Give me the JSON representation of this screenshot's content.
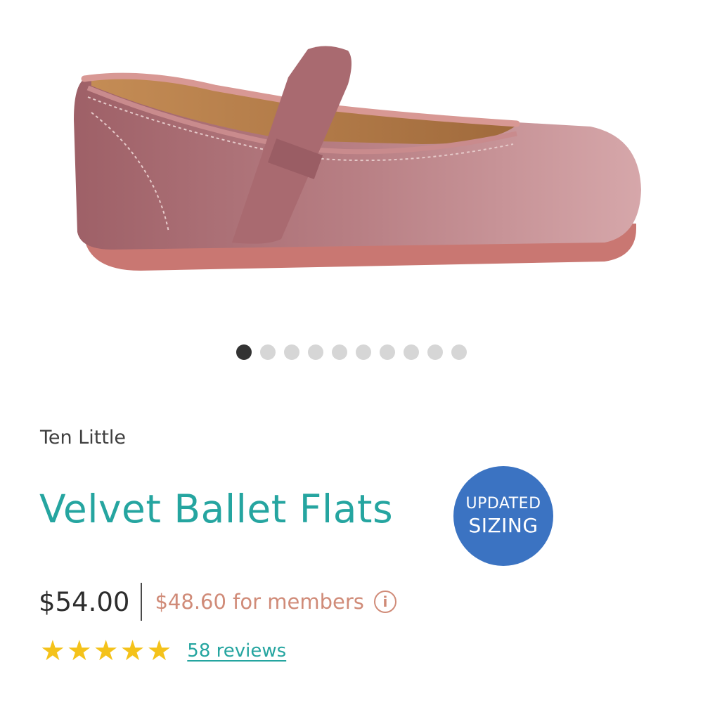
{
  "product": {
    "image_icon": "velvet-ballet-flat-image",
    "brand": "Ten Little",
    "title": "Velvet Ballet Flats",
    "badge": {
      "line1": "UPDATED",
      "line2": "SIZING"
    },
    "price": "$54.00",
    "member_price": "$48.60 for members",
    "info_icon": "i",
    "rating": {
      "stars": 5,
      "max": 5,
      "star_glyph": "★"
    },
    "reviews_link": "58 reviews"
  },
  "carousel": {
    "total": 10,
    "active_index": 0
  },
  "colors": {
    "title": "#25a5a0",
    "member_price": "#d08b78",
    "badge": "#3b73c2",
    "star": "#f4c21a",
    "shoe_velvet": "#b0757b"
  }
}
